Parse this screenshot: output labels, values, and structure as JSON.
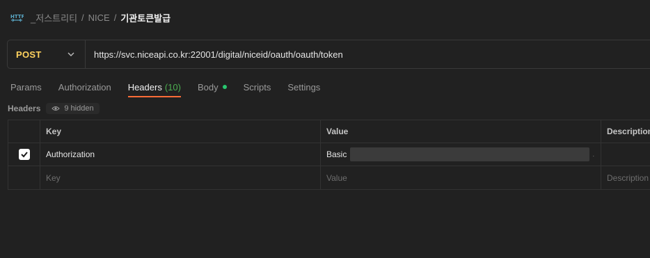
{
  "breadcrumb": {
    "collection": "_저스트리티",
    "folder": "NICE",
    "request": "기관토큰발급",
    "separator": "/"
  },
  "request": {
    "method": "POST",
    "url": "https://svc.niceapi.co.kr:22001/digital/niceid/oauth/oauth/token"
  },
  "tabs": [
    {
      "label": "Params"
    },
    {
      "label": "Authorization"
    },
    {
      "label": "Headers",
      "count": "(10)"
    },
    {
      "label": "Body"
    },
    {
      "label": "Scripts"
    },
    {
      "label": "Settings"
    }
  ],
  "active_tab": "Headers",
  "headers_section": {
    "label": "Headers",
    "hidden_label": "9 hidden"
  },
  "table": {
    "columns": [
      "Key",
      "Value",
      "Description"
    ],
    "rows": [
      {
        "checked": true,
        "key": "Authorization",
        "value": "Basic"
      }
    ],
    "empty_row": {
      "key_placeholder": "Key",
      "value_placeholder": "Value",
      "description_placeholder": "Description"
    }
  },
  "colors": {
    "accent_tab": "#ff6c37",
    "method_post": "#ffd25e",
    "body_dot": "#28c76f",
    "count_green": "#4caf50"
  }
}
